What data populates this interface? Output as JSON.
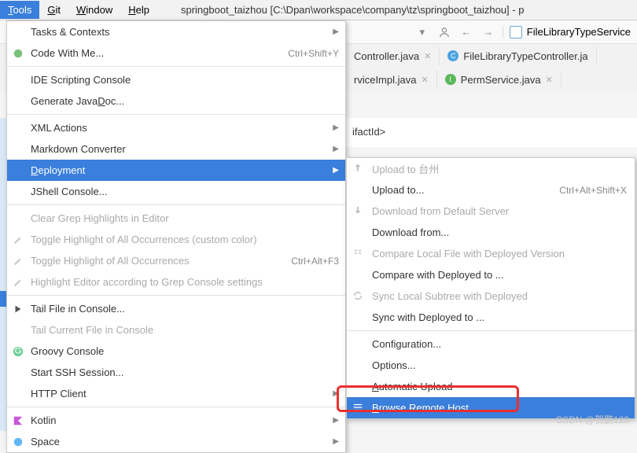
{
  "menubar": {
    "tools": "Tools",
    "git": "Git",
    "window": "Window",
    "help": "Help",
    "title": "springboot_taizhou [C:\\Dpan\\workspace\\company\\tz\\springboot_taizhou] - p"
  },
  "toolbar": {
    "search_file": "FileLibraryTypeService"
  },
  "tabs": {
    "row1": [
      {
        "icon": "C",
        "label": "Controller.java"
      },
      {
        "icon": "C",
        "label": "FileLibraryTypeController.ja"
      }
    ],
    "row2": [
      {
        "icon": "C",
        "label": "rviceImpl.java"
      },
      {
        "icon": "I",
        "label": "PermService.java"
      }
    ]
  },
  "editor": {
    "line": "ifactId>"
  },
  "menu": {
    "tasks": "Tasks & Contexts",
    "code_with_me": "Code With Me...",
    "code_with_me_shortcut": "Ctrl+Shift+Y",
    "ide_scripting": "IDE Scripting Console",
    "generate_javadoc": "Generate JavaDoc...",
    "xml_actions": "XML Actions",
    "markdown": "Markdown Converter",
    "deployment": "Deployment",
    "jshell": "JShell Console...",
    "clear_grep": "Clear Grep Highlights in Editor",
    "toggle_highlight_custom": "Toggle Highlight of All Occurrences (custom color)",
    "toggle_highlight": "Toggle Highlight of All Occurrences",
    "toggle_highlight_shortcut": "Ctrl+Alt+F3",
    "highlight_grep": "Highlight Editor according to Grep Console settings",
    "tail_file": "Tail File in Console...",
    "tail_current": "Tail Current File in Console",
    "groovy": "Groovy Console",
    "ssh": "Start SSH Session...",
    "http": "HTTP Client",
    "kotlin": "Kotlin",
    "space": "Space"
  },
  "submenu": {
    "upload_to_tz": "Upload to 台州",
    "upload_to": "Upload to...",
    "upload_to_shortcut": "Ctrl+Alt+Shift+X",
    "download_default": "Download from Default Server",
    "download_from": "Download from...",
    "compare_local": "Compare Local File with Deployed Version",
    "compare_deployed": "Compare with Deployed to ...",
    "sync_local": "Sync Local Subtree with Deployed",
    "sync_deployed": "Sync with Deployed to ...",
    "configuration": "Configuration...",
    "options": "Options...",
    "auto_upload": "Automatic Upload",
    "browse_remote": "Browse Remote Host"
  },
  "watermark": "CSDN @贺鹏123"
}
